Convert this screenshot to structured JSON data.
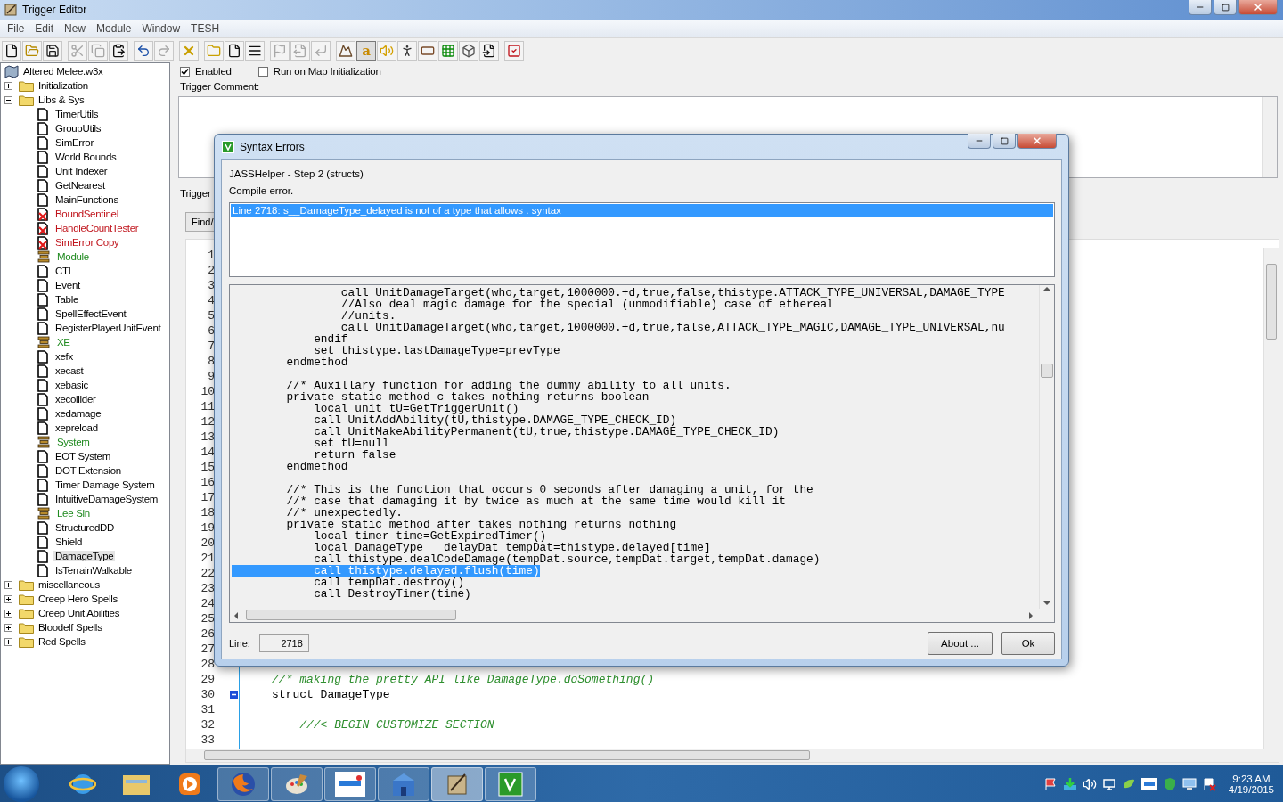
{
  "window": {
    "title": "Trigger Editor"
  },
  "menu": [
    "File",
    "Edit",
    "New",
    "Module",
    "Window",
    "TESH"
  ],
  "toolbar": [
    [
      {
        "kind": "new",
        "disabled": false,
        "pressed": false
      },
      {
        "kind": "open",
        "disabled": false,
        "pressed": false
      },
      {
        "kind": "save",
        "disabled": false,
        "pressed": false
      }
    ],
    [
      {
        "kind": "cut",
        "disabled": true,
        "pressed": false
      },
      {
        "kind": "copy",
        "disabled": true,
        "pressed": false
      },
      {
        "kind": "paste",
        "disabled": false,
        "pressed": false
      }
    ],
    [
      {
        "kind": "undo",
        "disabled": false,
        "pressed": false
      },
      {
        "kind": "redo",
        "disabled": true,
        "pressed": false
      }
    ],
    [
      {
        "kind": "delete",
        "disabled": false,
        "pressed": false
      }
    ],
    [
      {
        "kind": "folder",
        "disabled": false,
        "pressed": false
      },
      {
        "kind": "file",
        "disabled": false,
        "pressed": false
      },
      {
        "kind": "list",
        "disabled": false,
        "pressed": false
      }
    ],
    [
      {
        "kind": "flag",
        "disabled": true,
        "pressed": false
      },
      {
        "kind": "export",
        "disabled": true,
        "pressed": false
      },
      {
        "kind": "corner",
        "disabled": true,
        "pressed": false
      }
    ],
    [
      {
        "kind": "terrain",
        "disabled": false,
        "pressed": false
      },
      {
        "kind": "letter",
        "label": "a",
        "disabled": false,
        "pressed": true
      },
      {
        "kind": "sound",
        "disabled": false,
        "pressed": false
      },
      {
        "kind": "unit",
        "disabled": false,
        "pressed": false
      },
      {
        "kind": "panel",
        "disabled": false,
        "pressed": false
      },
      {
        "kind": "grid",
        "disabled": false,
        "pressed": false
      },
      {
        "kind": "box",
        "disabled": false,
        "pressed": false
      },
      {
        "kind": "import",
        "disabled": false,
        "pressed": false
      }
    ],
    [
      {
        "kind": "check",
        "disabled": false,
        "pressed": false
      }
    ]
  ],
  "tree": {
    "root": {
      "label": "Altered Melee.w3x"
    },
    "items": [
      {
        "kind": "folder",
        "label": "Initialization",
        "expanded": false,
        "selected": false
      },
      {
        "kind": "folder",
        "label": "Libs & Sys",
        "expanded": true,
        "selected": false,
        "children": [
          {
            "kind": "script",
            "label": "TimerUtils",
            "selected": false
          },
          {
            "kind": "script",
            "label": "GroupUtils",
            "selected": false
          },
          {
            "kind": "script",
            "label": "SimError",
            "selected": false
          },
          {
            "kind": "script",
            "label": "World Bounds",
            "selected": false
          },
          {
            "kind": "script",
            "label": "Unit Indexer",
            "selected": false
          },
          {
            "kind": "script",
            "label": "GetNearest",
            "selected": false
          },
          {
            "kind": "script",
            "label": "MainFunctions",
            "selected": false
          },
          {
            "kind": "error",
            "label": "BoundSentinel",
            "selected": false
          },
          {
            "kind": "error",
            "label": "HandleCountTester",
            "selected": false
          },
          {
            "kind": "error",
            "label": "SimError Copy",
            "selected": false
          },
          {
            "kind": "comment",
            "label": "Module",
            "selected": false
          },
          {
            "kind": "script",
            "label": "CTL",
            "selected": false
          },
          {
            "kind": "script",
            "label": "Event",
            "selected": false
          },
          {
            "kind": "script",
            "label": "Table",
            "selected": false
          },
          {
            "kind": "script",
            "label": "SpellEffectEvent",
            "selected": false
          },
          {
            "kind": "script",
            "label": "RegisterPlayerUnitEvent",
            "selected": false
          },
          {
            "kind": "comment",
            "label": "XE",
            "selected": false
          },
          {
            "kind": "script",
            "label": "xefx",
            "selected": false
          },
          {
            "kind": "script",
            "label": "xecast",
            "selected": false
          },
          {
            "kind": "script",
            "label": "xebasic",
            "selected": false
          },
          {
            "kind": "script",
            "label": "xecollider",
            "selected": false
          },
          {
            "kind": "script",
            "label": "xedamage",
            "selected": false
          },
          {
            "kind": "script",
            "label": "xepreload",
            "selected": false
          },
          {
            "kind": "comment",
            "label": "System",
            "selected": false
          },
          {
            "kind": "script",
            "label": "EOT System",
            "selected": false
          },
          {
            "kind": "script",
            "label": "DOT Extension",
            "selected": false
          },
          {
            "kind": "script",
            "label": "Timer Damage System",
            "selected": false
          },
          {
            "kind": "script",
            "label": "IntuitiveDamageSystem",
            "selected": false
          },
          {
            "kind": "comment",
            "label": "Lee Sin",
            "selected": false
          },
          {
            "kind": "script",
            "label": "StructuredDD",
            "selected": false
          },
          {
            "kind": "script",
            "label": "Shield",
            "selected": false
          },
          {
            "kind": "script",
            "label": "DamageType",
            "selected": true
          },
          {
            "kind": "script",
            "label": "IsTerrainWalkable",
            "selected": false
          }
        ]
      },
      {
        "kind": "folder",
        "label": "miscellaneous",
        "expanded": false,
        "selected": false
      },
      {
        "kind": "folder",
        "label": "Creep Hero Spells",
        "expanded": false,
        "selected": false
      },
      {
        "kind": "folder",
        "label": "Creep Unit Abilities",
        "expanded": false,
        "selected": false
      },
      {
        "kind": "folder",
        "label": "Bloodelf Spells",
        "expanded": false,
        "selected": false
      },
      {
        "kind": "folder",
        "label": "Red Spells",
        "expanded": false,
        "selected": false
      }
    ]
  },
  "trigger": {
    "enabled": {
      "label": "Enabled",
      "checked": true
    },
    "run_on_init": {
      "label": "Run on Map Initialization",
      "checked": false
    },
    "comment_label": "Trigger Comment:",
    "text_label": "Trigger",
    "find_button": "Find/"
  },
  "editor": {
    "lines": [
      {
        "number": "1",
        "kind": "plain"
      },
      {
        "number": "2",
        "kind": "plain"
      },
      {
        "number": "3",
        "kind": "plain"
      },
      {
        "number": "4",
        "kind": "plain"
      },
      {
        "number": "5",
        "kind": "plain"
      },
      {
        "number": "6",
        "kind": "plain"
      },
      {
        "number": "7",
        "kind": "plain"
      },
      {
        "number": "8",
        "kind": "plain"
      },
      {
        "number": "9",
        "kind": "plain"
      },
      {
        "number": "10",
        "kind": "plain"
      },
      {
        "number": "11",
        "kind": "plain"
      },
      {
        "number": "12",
        "kind": "plain"
      },
      {
        "number": "13",
        "kind": "plain"
      },
      {
        "number": "14",
        "kind": "plain"
      },
      {
        "number": "15",
        "kind": "plain"
      },
      {
        "number": "16",
        "kind": "plain"
      },
      {
        "number": "17",
        "kind": "plain"
      },
      {
        "number": "18",
        "kind": "plain"
      },
      {
        "number": "19",
        "kind": "plain"
      },
      {
        "number": "20",
        "kind": "plain"
      },
      {
        "number": "21",
        "kind": "plain"
      },
      {
        "number": "22",
        "kind": "plain"
      },
      {
        "number": "23",
        "kind": "plain"
      },
      {
        "number": "24",
        "kind": "plain"
      },
      {
        "number": "25",
        "kind": "plain"
      },
      {
        "number": "26",
        "kind": "plain"
      },
      {
        "number": "27",
        "kind": "plain"
      },
      {
        "number": "28",
        "kind": "plain"
      },
      {
        "number": "29",
        "kind": "comment",
        "text": "//* making the pretty API like DamageType.doSomething()"
      },
      {
        "number": "30",
        "kind": "fold",
        "text": "struct DamageType"
      },
      {
        "number": "31",
        "kind": "plain"
      },
      {
        "number": "32",
        "kind": "comment",
        "text": "    ///< BEGIN CUSTOMIZE SECTION"
      },
      {
        "number": "33",
        "kind": "plain"
      }
    ]
  },
  "dialog": {
    "title": "Syntax Errors",
    "step": "JASSHelper - Step 2 (structs)",
    "status": "Compile error.",
    "errors": [
      {
        "text": "Line 2718: s__DamageType_delayed is not of a type that allows . syntax",
        "selected": true
      }
    ],
    "code": [
      {
        "text": "                call UnitDamageTarget(who,target,1000000.+d,true,false,thistype.ATTACK_TYPE_UNIVERSAL,DAMAGE_TYPE",
        "selected": false
      },
      {
        "text": "                //Also deal magic damage for the special (unmodifiable) case of ethereal",
        "selected": false
      },
      {
        "text": "                //units.",
        "selected": false
      },
      {
        "text": "                call UnitDamageTarget(who,target,1000000.+d,true,false,ATTACK_TYPE_MAGIC,DAMAGE_TYPE_UNIVERSAL,nu",
        "selected": false
      },
      {
        "text": "            endif",
        "selected": false
      },
      {
        "text": "            set thistype.lastDamageType=prevType",
        "selected": false
      },
      {
        "text": "        endmethod",
        "selected": false
      },
      {
        "kind": "blank"
      },
      {
        "text": "        //* Auxillary function for adding the dummy ability to all units.",
        "selected": false
      },
      {
        "text": "        private static method c takes nothing returns boolean",
        "selected": false
      },
      {
        "text": "            local unit tU=GetTriggerUnit()",
        "selected": false
      },
      {
        "text": "            call UnitAddAbility(tU,thistype.DAMAGE_TYPE_CHECK_ID)",
        "selected": false
      },
      {
        "text": "            call UnitMakeAbilityPermanent(tU,true,thistype.DAMAGE_TYPE_CHECK_ID)",
        "selected": false
      },
      {
        "text": "            set tU=null",
        "selected": false
      },
      {
        "text": "            return false",
        "selected": false
      },
      {
        "text": "        endmethod",
        "selected": false
      },
      {
        "kind": "blank"
      },
      {
        "text": "        //* This is the function that occurs 0 seconds after damaging a unit, for the",
        "selected": false
      },
      {
        "text": "        //* case that damaging it by twice as much at the same time would kill it",
        "selected": false
      },
      {
        "text": "        //* unexpectedly.",
        "selected": false
      },
      {
        "text": "        private static method after takes nothing returns nothing",
        "selected": false
      },
      {
        "text": "            local timer time=GetExpiredTimer()",
        "selected": false
      },
      {
        "text": "            local DamageType___delayDat tempDat=thistype.delayed[time]",
        "selected": false
      },
      {
        "text": "            call thistype.dealCodeDamage(tempDat.source,tempDat.target,tempDat.damage)",
        "selected": false
      },
      {
        "text": "            call thistype.delayed.flush(time)",
        "selected": true
      },
      {
        "text": "            call tempDat.destroy()",
        "selected": false
      },
      {
        "text": "            call DestroyTimer(time)",
        "selected": false
      }
    ],
    "line_label": "Line:",
    "line_value": "2718",
    "buttons": [
      "About ...",
      "Ok"
    ]
  },
  "taskbar": {
    "items": [
      {
        "kind": "ie",
        "running": false,
        "active": false
      },
      {
        "kind": "explorer",
        "running": false,
        "active": false
      },
      {
        "kind": "media",
        "running": false,
        "active": false
      },
      {
        "kind": "firefox",
        "running": true,
        "active": false
      },
      {
        "kind": "paint",
        "running": true,
        "active": false
      },
      {
        "kind": "smart",
        "running": true,
        "active": false
      },
      {
        "kind": "building",
        "running": true,
        "active": false
      },
      {
        "kind": "scroll",
        "running": true,
        "active": true
      },
      {
        "kind": "jass",
        "running": true,
        "active": false
      }
    ],
    "time": "9:23 AM",
    "date": "4/19/2015"
  }
}
